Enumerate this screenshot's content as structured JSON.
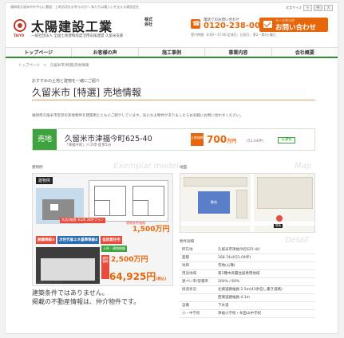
{
  "header": {
    "tagline": "福岡県久留米市を中心に農園・土地活用をお考えの方へ 私たちは暮らしを支える建設会社",
    "font_size_label": "文字サイズ",
    "font_sizes": [
      "小",
      "中",
      "大"
    ],
    "logo_sub": "TAIYO",
    "company_name": "太陽建設工業",
    "company_suffix": "株式会社",
    "company_desc": "一般社団法人 全国土地建物高度活用支援連盟 久留米支部",
    "phone_label": "電話でのお問い合わせ",
    "phone_number": "0120-238-005",
    "phone_hours": "受付時間：8:00〜17:00 定休日：日祝日、第2・第4土曜日",
    "contact_sub": "メールからの",
    "contact_label": "お問い合わせ"
  },
  "nav": [
    "トップページ",
    "お客様の声",
    "施工事例",
    "事業内容",
    "会社概要"
  ],
  "breadcrumb": "トップページ　>　久留米市[特選]売地情報",
  "page": {
    "catch": "おすすめの土地と建物を一緒にご紹介",
    "title": "久留米市 [特選] 売地情報",
    "intro": "福岡県久留米市近郊の売地物件を建築例とともにご紹介しています。気になる物件がありましたらお気軽にお問い合わせください。"
  },
  "property": {
    "badge": "売地",
    "name": "久留米市津福今町625-40",
    "access": "「津福今町」バス停 徒歩5分",
    "price_tag": "土地価格",
    "price": "700",
    "price_unit": "万円",
    "tsubo": "(51.04坪)",
    "status": "非課税"
  },
  "example": {
    "label": "建物例",
    "watermark": "Exemplar model",
    "tag": "建物例",
    "plan_tag": "木造2階建 3LDK 28坪プラン",
    "plan_price_label": "建物参考価格",
    "plan_price": "1,500万円",
    "features": [
      "耐震等級3",
      "次世代省エネ基準等級4",
      "低炭素住宅"
    ],
    "sum_green": "土地・建物総額",
    "sum_tag": "建物価格",
    "sum_price1": "2,500万円",
    "sum_price2": "64,925円",
    "sum_unit": "(税込)",
    "bottom_label": "外観写真は一例です",
    "disclaimer_line1": "建築条件ではありません。",
    "disclaimer_line2": "掲載の不動産情報は、仲介物件です。"
  },
  "map": {
    "label": "地図",
    "watermark": "Map",
    "site_label": "敷地",
    "pin_label": "現地"
  },
  "details": {
    "label": "物件詳細",
    "watermark": "Detail",
    "rows": [
      {
        "k": "所在地",
        "v": "久留米市津福今町625-40"
      },
      {
        "k": "面積",
        "v": "168.74㎡(51.04坪)"
      },
      {
        "k": "地目",
        "v": "宅地(公簿)"
      },
      {
        "k": "用途地域",
        "v": "第1種中高層住居専用地域"
      },
      {
        "k": "建ぺい率/容積率",
        "v": "200% / 60%"
      },
      {
        "k": "接道状況",
        "v": "北側道路幅員 2.5m(43条但し書き道路)"
      },
      {
        "k": "",
        "v": "西側道路幅員 4.1m"
      },
      {
        "k": "設備",
        "v": "下水道"
      },
      {
        "k": "小・中学校",
        "v": "津福小学校・牟田山中学校"
      }
    ]
  }
}
